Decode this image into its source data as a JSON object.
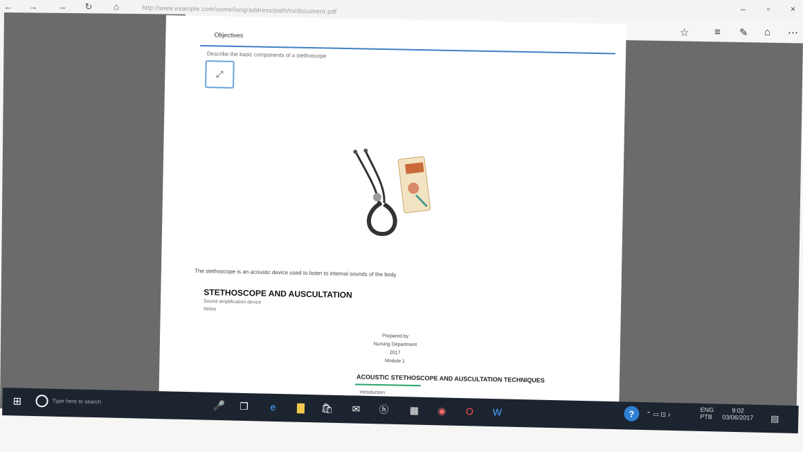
{
  "browser": {
    "nav": {
      "back": "←",
      "forward": "→",
      "refresh": "↻",
      "home": "⌂"
    },
    "url": "http://www.example.com/some/long/address/path/to/document.pdf",
    "window_controls": {
      "minimize": "–",
      "restore": "▫",
      "close": "×"
    },
    "toolbar_icons": [
      "favorites-icon",
      "reading-list-icon",
      "notes-icon",
      "share-icon",
      "more-icon"
    ]
  },
  "document": {
    "tab_label": "Objectives",
    "subtitle_line": "Describe the basic components of a stethoscope",
    "heading": "STETHOSCOPE AND AUSCULTATION",
    "sub_line": "Sound amplification device",
    "sub_line2": "Notes",
    "caption": "The stethoscope is an acoustic device used to listen to internal sounds of the body",
    "center_lines": [
      "Prepared by",
      "Nursing Department",
      "2017",
      "Module 1"
    ],
    "footer_bold": "ACOUSTIC STETHOSCOPE AND AUSCULTATION TECHNIQUES",
    "footer_small": "Introduction"
  },
  "taskbar": {
    "search_placeholder": "Type here to search",
    "clock_time": "9:02",
    "clock_date": "03/06/2017",
    "language_top": "ENG",
    "language_bottom": "PTB"
  },
  "colors": {
    "accent_blue": "#3f7fc4",
    "taskbar_bg": "#1c2430",
    "panel_gray": "#6b6b6b"
  }
}
